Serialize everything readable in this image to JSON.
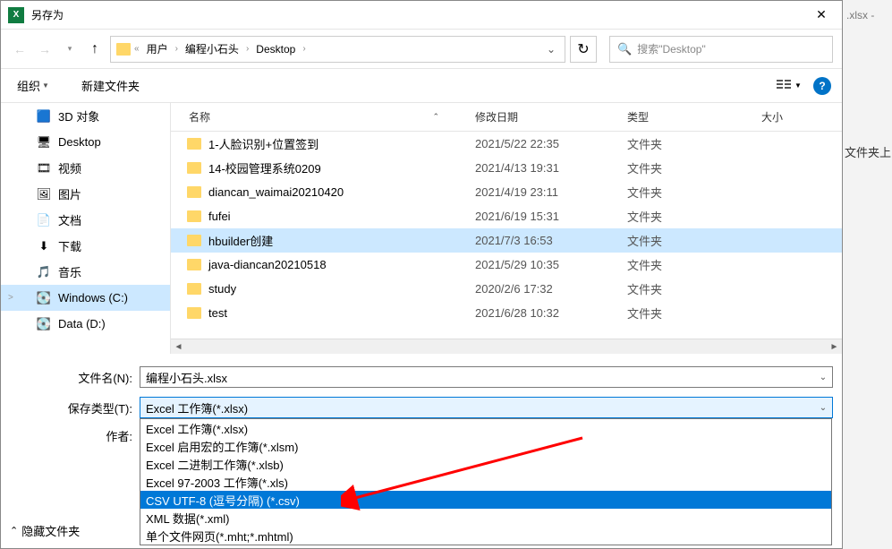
{
  "title": "另存为",
  "breadcrumbs": [
    "用户",
    "编程小石头",
    "Desktop"
  ],
  "search_placeholder": "搜索\"Desktop\"",
  "toolbar": {
    "organize": "组织",
    "new_folder": "新建文件夹"
  },
  "sidebar": [
    {
      "label": "3D 对象",
      "icon": "🟦"
    },
    {
      "label": "Desktop",
      "icon": "🖥"
    },
    {
      "label": "视频",
      "icon": "🎞"
    },
    {
      "label": "图片",
      "icon": "🖼"
    },
    {
      "label": "文档",
      "icon": "📄"
    },
    {
      "label": "下载",
      "icon": "⬇"
    },
    {
      "label": "音乐",
      "icon": "🎵"
    },
    {
      "label": "Windows (C:)",
      "icon": "💽",
      "selected": true,
      "expand": ">"
    },
    {
      "label": "Data (D:)",
      "icon": "💽"
    }
  ],
  "columns": {
    "name": "名称",
    "date": "修改日期",
    "type": "类型",
    "size": "大小"
  },
  "files": [
    {
      "name": "1-人脸识别+位置签到",
      "date": "2021/5/22 22:35",
      "type": "文件夹"
    },
    {
      "name": "14-校园管理系统0209",
      "date": "2021/4/13 19:31",
      "type": "文件夹"
    },
    {
      "name": "diancan_waimai20210420",
      "date": "2021/4/19 23:11",
      "type": "文件夹"
    },
    {
      "name": "fufei",
      "date": "2021/6/19 15:31",
      "type": "文件夹"
    },
    {
      "name": "hbuilder创建",
      "date": "2021/7/3 16:53",
      "type": "文件夹",
      "selected": true
    },
    {
      "name": "java-diancan20210518",
      "date": "2021/5/29 10:35",
      "type": "文件夹"
    },
    {
      "name": "study",
      "date": "2020/2/6 17:32",
      "type": "文件夹"
    },
    {
      "name": "test",
      "date": "2021/6/28 10:32",
      "type": "文件夹"
    }
  ],
  "form": {
    "filename_label": "文件名(N):",
    "filename_value": "编程小石头.xlsx",
    "filetype_label": "保存类型(T):",
    "filetype_value": "Excel 工作簿(*.xlsx)",
    "author_label": "作者:"
  },
  "filetype_options": [
    "Excel 工作簿(*.xlsx)",
    "Excel 启用宏的工作簿(*.xlsm)",
    "Excel 二进制工作簿(*.xlsb)",
    "Excel 97-2003 工作簿(*.xls)",
    "CSV UTF-8 (逗号分隔) (*.csv)",
    "XML 数据(*.xml)",
    "单个文件网页(*.mht;*.mhtml)"
  ],
  "filetype_highlighted_index": 4,
  "hide_folders": "隐藏文件夹",
  "right_strip": {
    "xlsx": ".xlsx -",
    "frag": "文件夹上"
  }
}
